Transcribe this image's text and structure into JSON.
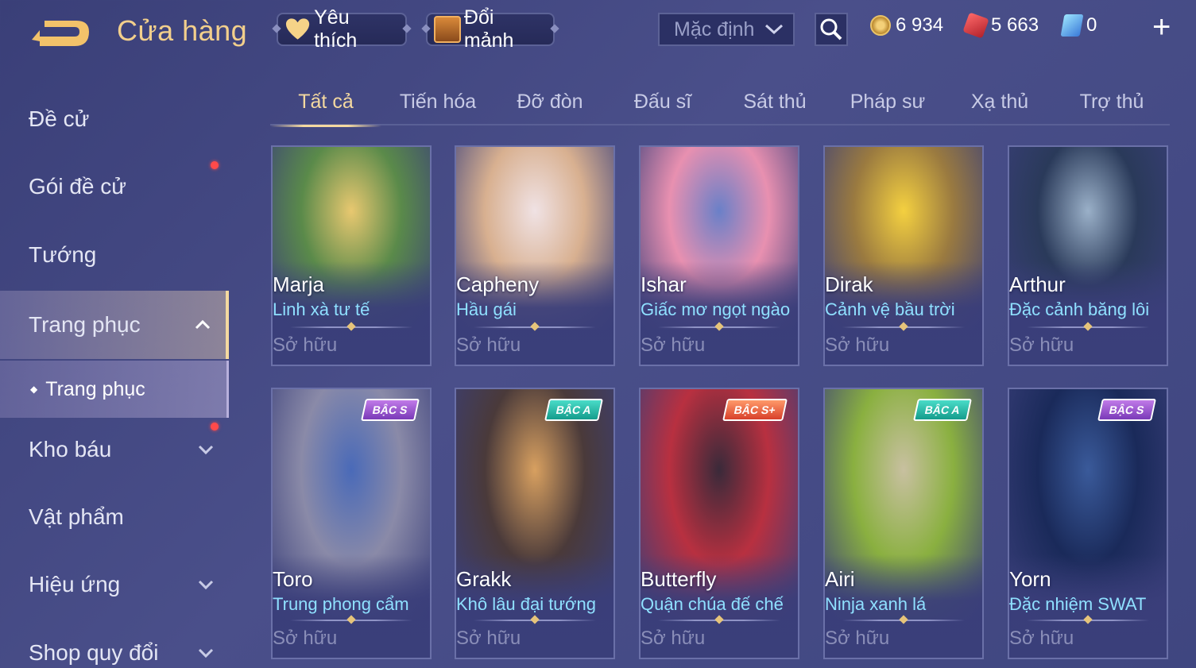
{
  "header": {
    "title": "Cửa hàng",
    "favorite_label": "Yêu thích",
    "shards_label": "Đổi mảnh",
    "sort_value": "Mặc định",
    "currencies": {
      "gold": "6 934",
      "ruby": "5 663",
      "ticket": "0"
    },
    "plus_label": "+"
  },
  "sidebar": {
    "items": [
      {
        "label": "Đề cử"
      },
      {
        "label": "Gói đề cử"
      },
      {
        "label": "Tướng"
      },
      {
        "label": "Trang phục"
      },
      {
        "label": "Kho báu"
      },
      {
        "label": "Vật phẩm"
      },
      {
        "label": "Hiệu ứng"
      },
      {
        "label": "Shop quy đổi"
      }
    ],
    "sub_item": "Trang phục"
  },
  "tabs": [
    "Tất cả",
    "Tiến hóa",
    "Đỡ đòn",
    "Đấu sĩ",
    "Sát thủ",
    "Pháp sư",
    "Xạ thủ",
    "Trợ thủ"
  ],
  "cards": [
    {
      "hero": "Marja",
      "skin": "Linh xà tư tế",
      "status": "Sở hữu",
      "tier": "",
      "palette": [
        "#e8c870",
        "#5a8a4a",
        "#3a3f7a"
      ]
    },
    {
      "hero": "Capheny",
      "skin": "Hầu gái",
      "status": "Sở hữu",
      "tier": "",
      "palette": [
        "#f0e2e4",
        "#d8b090",
        "#3a3f7a"
      ]
    },
    {
      "hero": "Ishar",
      "skin": "Giấc mơ ngọt ngào",
      "status": "Sở hữu",
      "tier": "",
      "palette": [
        "#6a80c8",
        "#e890b0",
        "#3a3f7a"
      ]
    },
    {
      "hero": "Dirak",
      "skin": "Cảnh vệ bầu trời",
      "status": "Sở hữu",
      "tier": "",
      "palette": [
        "#f4d040",
        "#9a7a40",
        "#3a3f7a"
      ]
    },
    {
      "hero": "Arthur",
      "skin": "Đặc cảnh băng lôi",
      "status": "Sở hữu",
      "tier": "",
      "palette": [
        "#9ab0c8",
        "#2a3a5a",
        "#3a3f7a"
      ]
    },
    {
      "hero": "Toro",
      "skin": "Trung phong cẩm",
      "status": "Sở hữu",
      "tier": "BẬC S",
      "palette": [
        "#4a6ab8",
        "#8a8aa8",
        "#3a3f7a"
      ]
    },
    {
      "hero": "Grakk",
      "skin": "Khô lâu đại tướng",
      "status": "Sở hữu",
      "tier": "BẬC A",
      "palette": [
        "#d8a060",
        "#4a3a3a",
        "#3a3f7a"
      ]
    },
    {
      "hero": "Butterfly",
      "skin": "Quận chúa đế chế",
      "status": "Sở hữu",
      "tier": "BẬC S+",
      "palette": [
        "#3a2a3a",
        "#b83040",
        "#3a3f7a"
      ]
    },
    {
      "hero": "Airi",
      "skin": "Ninja xanh lá",
      "status": "Sở hữu",
      "tier": "BẬC A",
      "palette": [
        "#c8c0a0",
        "#8ab040",
        "#3a3f7a"
      ]
    },
    {
      "hero": "Yorn",
      "skin": "Đặc nhiệm SWAT",
      "status": "Sở hữu",
      "tier": "BẬC S",
      "palette": [
        "#3a5a9a",
        "#1a2a5a",
        "#3a3f7a"
      ]
    }
  ],
  "colors": {
    "accent_gold": "#f4d9a0",
    "skin_cyan": "#8fe0ff",
    "owned_gray": "#8a8eb8"
  },
  "icons": [
    "back-arrow-icon",
    "heart-icon",
    "chest-icon",
    "chevron-down-icon",
    "search-icon",
    "coin-icon",
    "ruby-icon",
    "ticket-icon",
    "plus-icon",
    "chevron-up-icon"
  ]
}
